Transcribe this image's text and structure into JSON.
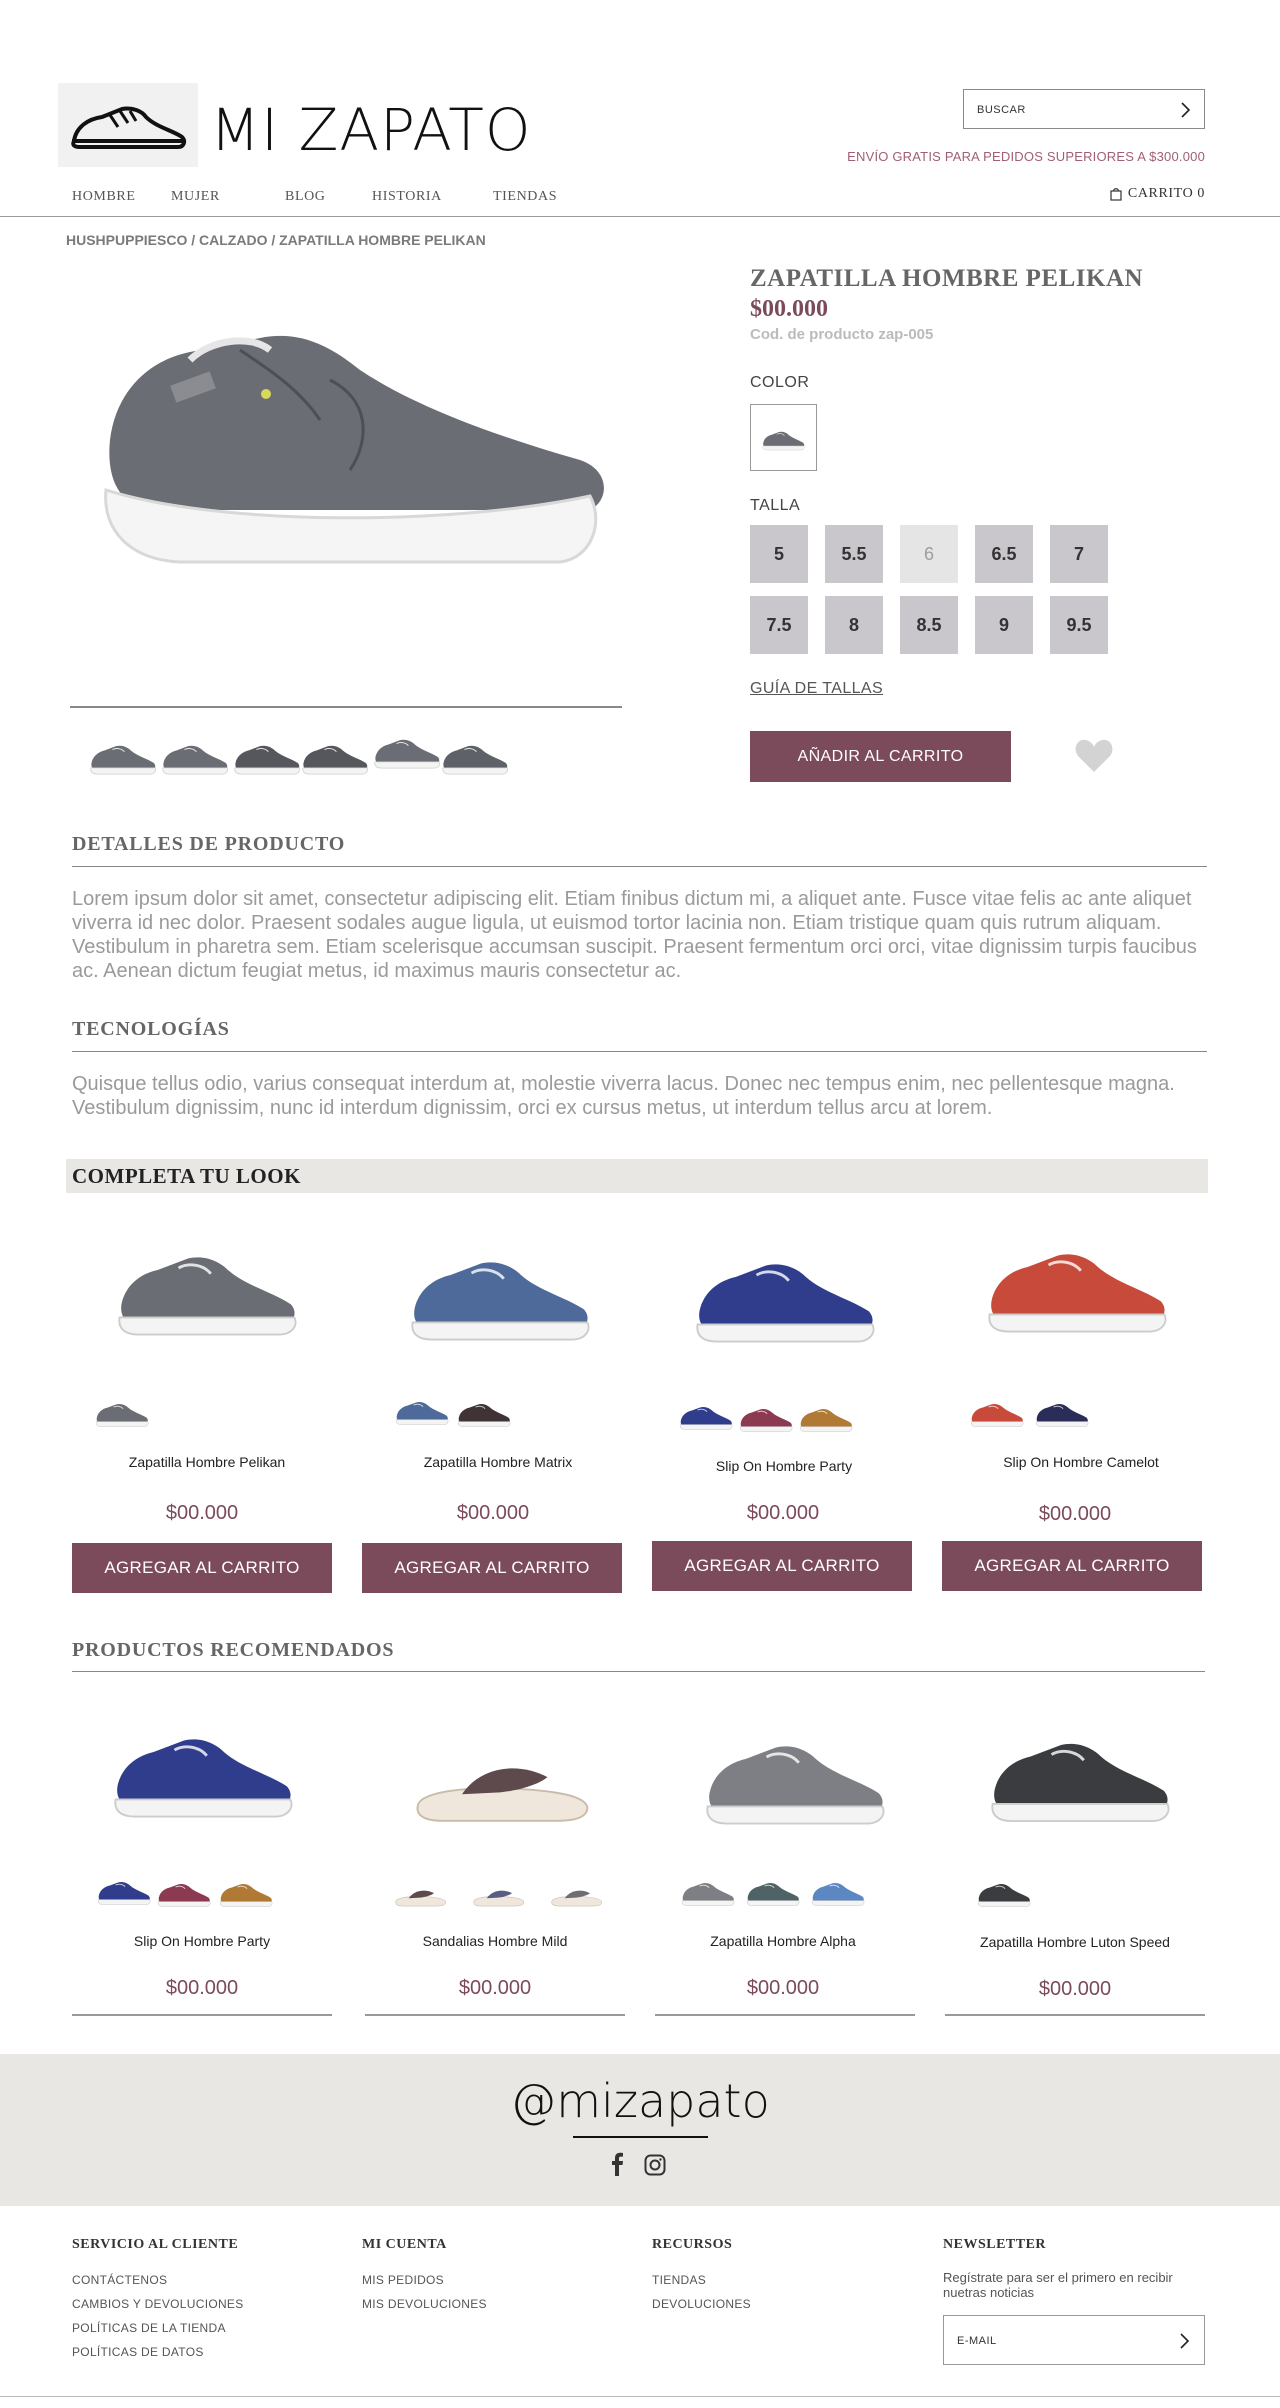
{
  "header": {
    "brand": "MI ZAPATO",
    "search_placeholder": "BUSCAR",
    "shipping_notice": "ENVÍO GRATIS PARA PEDIDOS SUPERIORES A $300.000",
    "nav": [
      "HOMBRE",
      "MUJER",
      "BLOG",
      "HISTORIA",
      "TIENDAS"
    ],
    "cart_label": "CARRITO 0"
  },
  "breadcrumb": "HUSHPUPPIESCO / CALZADO / ZAPATILLA HOMBRE PELIKAN",
  "product": {
    "title": "ZAPATILLA HOMBRE PELIKAN",
    "price": "$00.000",
    "code": "Cod. de producto zap-005",
    "color_label": "COLOR",
    "size_label": "TALLA",
    "sizes": [
      "5",
      "5.5",
      "6",
      "6.5",
      "7",
      "7.5",
      "8",
      "8.5",
      "9",
      "9.5"
    ],
    "unavailable_size": "6",
    "size_guide": "GUÍA DE TALLAS",
    "add_to_cart": "AÑADIR AL CARRITO"
  },
  "details": {
    "title": "DETALLES DE PRODUCTO",
    "text": "Lorem ipsum dolor sit amet, consectetur adipiscing elit. Etiam finibus dictum mi, a aliquet ante. Fusce vitae felis ac ante aliquet viverra id nec dolor. Praesent sodales augue ligula, ut euismod tortor lacinia non. Etiam tristique quam quis rutrum aliquam. Vestibulum in pharetra sem. Etiam scelerisque accumsan suscipit. Praesent fermentum orci orci, vitae dignissim turpis faucibus ac. Aenean dictum feugiat metus, id maximus mauris consectetur ac."
  },
  "technologies": {
    "title": "TECNOLOGÍAS",
    "text": "Quisque tellus odio, varius consequat interdum at, molestie viverra lacus. Donec nec tempus enim, nec pellentesque magna. Vestibulum dignissim, nunc id interdum dignissim, orci ex cursus metus, ut interdum tellus arcu at lorem."
  },
  "complete_look": {
    "title": "COMPLETA TU LOOK",
    "button_label": "AGREGAR AL CARRITO",
    "items": [
      {
        "name": "Zapatilla Hombre Pelikan",
        "price": "$00.000"
      },
      {
        "name": "Zapatilla Hombre Matrix",
        "price": "$00.000"
      },
      {
        "name": "Slip On Hombre Party",
        "price": "$00.000"
      },
      {
        "name": "Slip On Hombre Camelot",
        "price": "$00.000"
      }
    ]
  },
  "recommended": {
    "title": "PRODUCTOS RECOMENDADOS",
    "items": [
      {
        "name": "Slip On Hombre Party",
        "price": "$00.000"
      },
      {
        "name": "Sandalias Hombre Mild",
        "price": "$00.000"
      },
      {
        "name": "Zapatilla Hombre Alpha",
        "price": "$00.000"
      },
      {
        "name": "Zapatilla Hombre Luton Speed",
        "price": "$00.000"
      }
    ]
  },
  "social": {
    "handle": "@mizapato"
  },
  "footer": {
    "customer_service": {
      "title": "SERVICIO AL CLIENTE",
      "links": [
        "CONTÁCTENOS",
        "CAMBIOS Y DEVOLUCIONES",
        "POLÍTICAS DE LA TIENDA",
        "POLÍTICAS DE DATOS"
      ]
    },
    "my_account": {
      "title": "MI CUENTA",
      "links": [
        "MIS PEDIDOS",
        "MIS DEVOLUCIONES"
      ]
    },
    "resources": {
      "title": "RECURSOS",
      "links": [
        "TIENDAS",
        "DEVOLUCIONES"
      ]
    },
    "newsletter": {
      "title": "NEWSLETTER",
      "text": "Regístrate para ser el primero en recibir nuetras noticias",
      "email_placeholder": "E-MAIL"
    }
  },
  "colors": {
    "accent": "#7b4a5b",
    "band": "#e8e7e4"
  }
}
